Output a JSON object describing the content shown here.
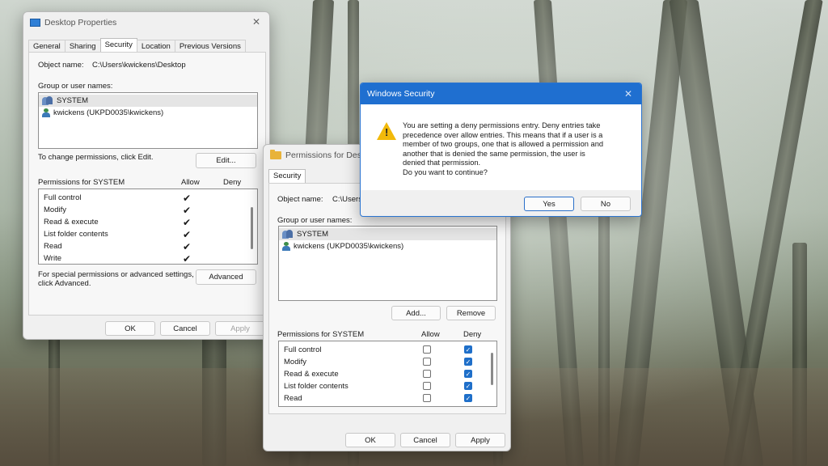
{
  "desktop_props": {
    "title": "Desktop Properties",
    "tabs": [
      "General",
      "Sharing",
      "Security",
      "Location",
      "Previous Versions"
    ],
    "object_label": "Object name:",
    "object_value": "C:\\Users\\kwickens\\Desktop",
    "group_label": "Group or user names:",
    "users": [
      "SYSTEM",
      "kwickens (UKPD0035\\kwickens)"
    ],
    "change_text": "To change permissions, click Edit.",
    "edit_btn": "Edit...",
    "perm_header": "Permissions for SYSTEM",
    "allow_hdr": "Allow",
    "deny_hdr": "Deny",
    "perms": [
      "Full control",
      "Modify",
      "Read & execute",
      "List folder contents",
      "Read",
      "Write"
    ],
    "special_text_1": "For special permissions or advanced settings,",
    "special_text_2": "click Advanced.",
    "advanced_btn": "Advanced",
    "ok": "OK",
    "cancel": "Cancel",
    "apply": "Apply"
  },
  "perms_dialog": {
    "title": "Permissions for Deskt",
    "tab": "Security",
    "object_label": "Object name:",
    "object_value": "C:\\Users",
    "group_label": "Group or user names:",
    "users": [
      "SYSTEM",
      "kwickens (UKPD0035\\kwickens)"
    ],
    "add_btn": "Add...",
    "remove_btn": "Remove",
    "perm_header": "Permissions for SYSTEM",
    "allow_hdr": "Allow",
    "deny_hdr": "Deny",
    "perms": [
      "Full control",
      "Modify",
      "Read & execute",
      "List folder contents",
      "Read"
    ],
    "ok": "OK",
    "cancel": "Cancel",
    "apply": "Apply"
  },
  "security_alert": {
    "title": "Windows Security",
    "lines": [
      "You are setting a deny permissions entry. Deny entries take",
      "precedence over allow entries. This means that if a user is a",
      "member of two groups, one that is allowed a permission and",
      "another that is denied the same permission, the user is",
      "denied that permission.",
      "Do you want to continue?"
    ],
    "yes": "Yes",
    "no": "No"
  },
  "icons": {
    "check": "✔",
    "deny_check": "✓",
    "close": "✕",
    "warn": "!"
  }
}
